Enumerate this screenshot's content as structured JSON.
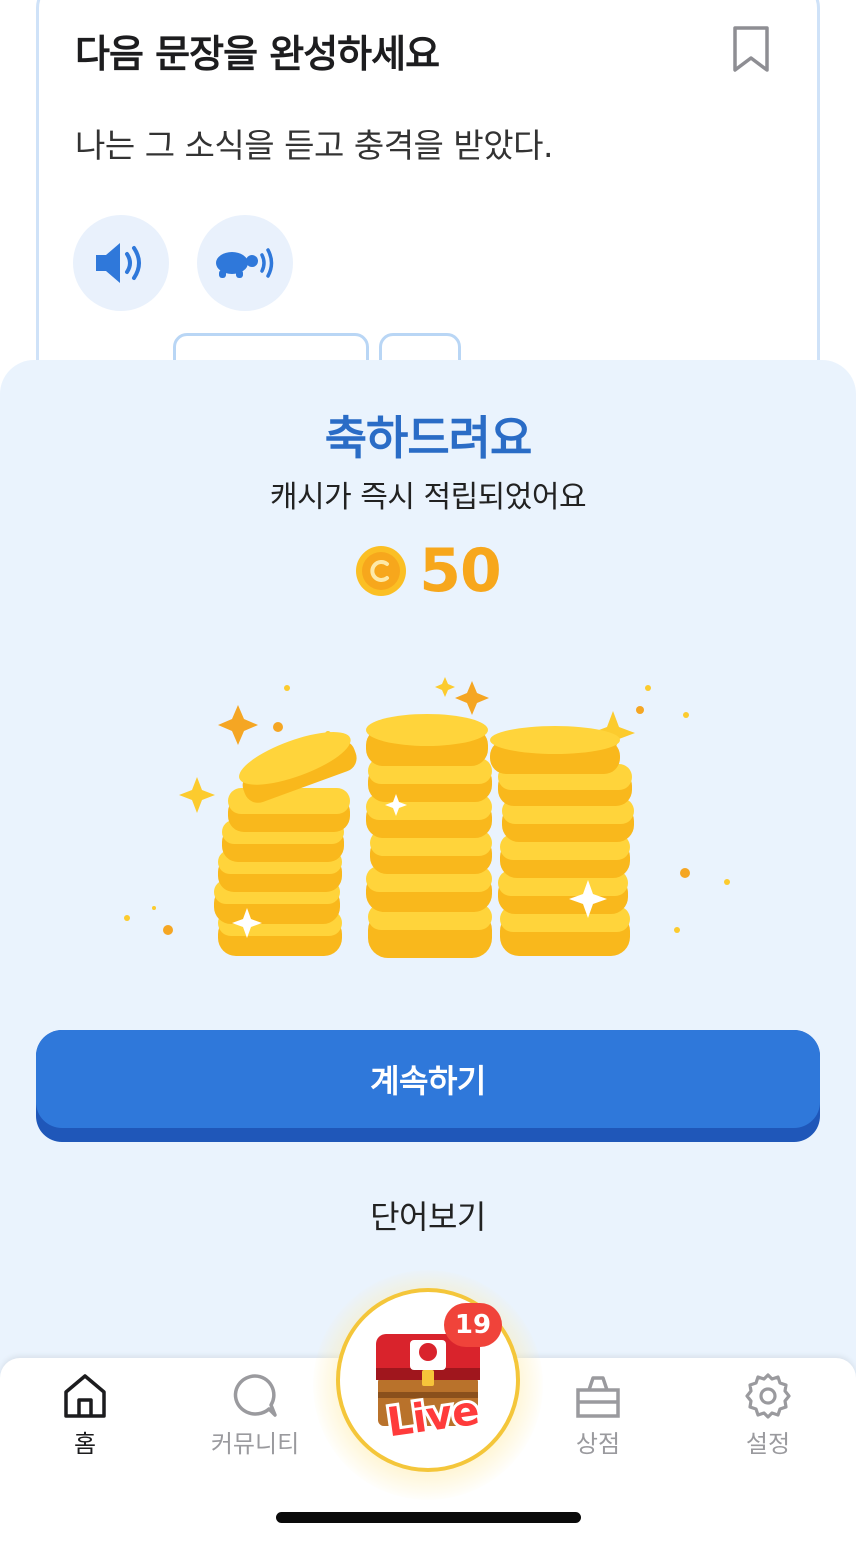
{
  "question_card": {
    "title": "다음 문장을 완성하세요",
    "sentence": "나는 그 소식을 듣고 충격을 받았다."
  },
  "reward_sheet": {
    "title": "축하드려요",
    "subtitle": "캐시가 즉시 적립되었어요",
    "amount": "50",
    "continue_label": "계속하기",
    "words_label": "단어보기"
  },
  "tabbar": {
    "home": "홈",
    "community": "커뮤니티",
    "live_badge": "19",
    "live_label": "Live",
    "shop": "상점",
    "settings": "설정"
  },
  "colors": {
    "primary": "#2f78da",
    "title_blue": "#2a6cc6",
    "coin": "#f7a71c",
    "sheet_bg": "#eaf3fd",
    "badge": "#f0433a"
  }
}
